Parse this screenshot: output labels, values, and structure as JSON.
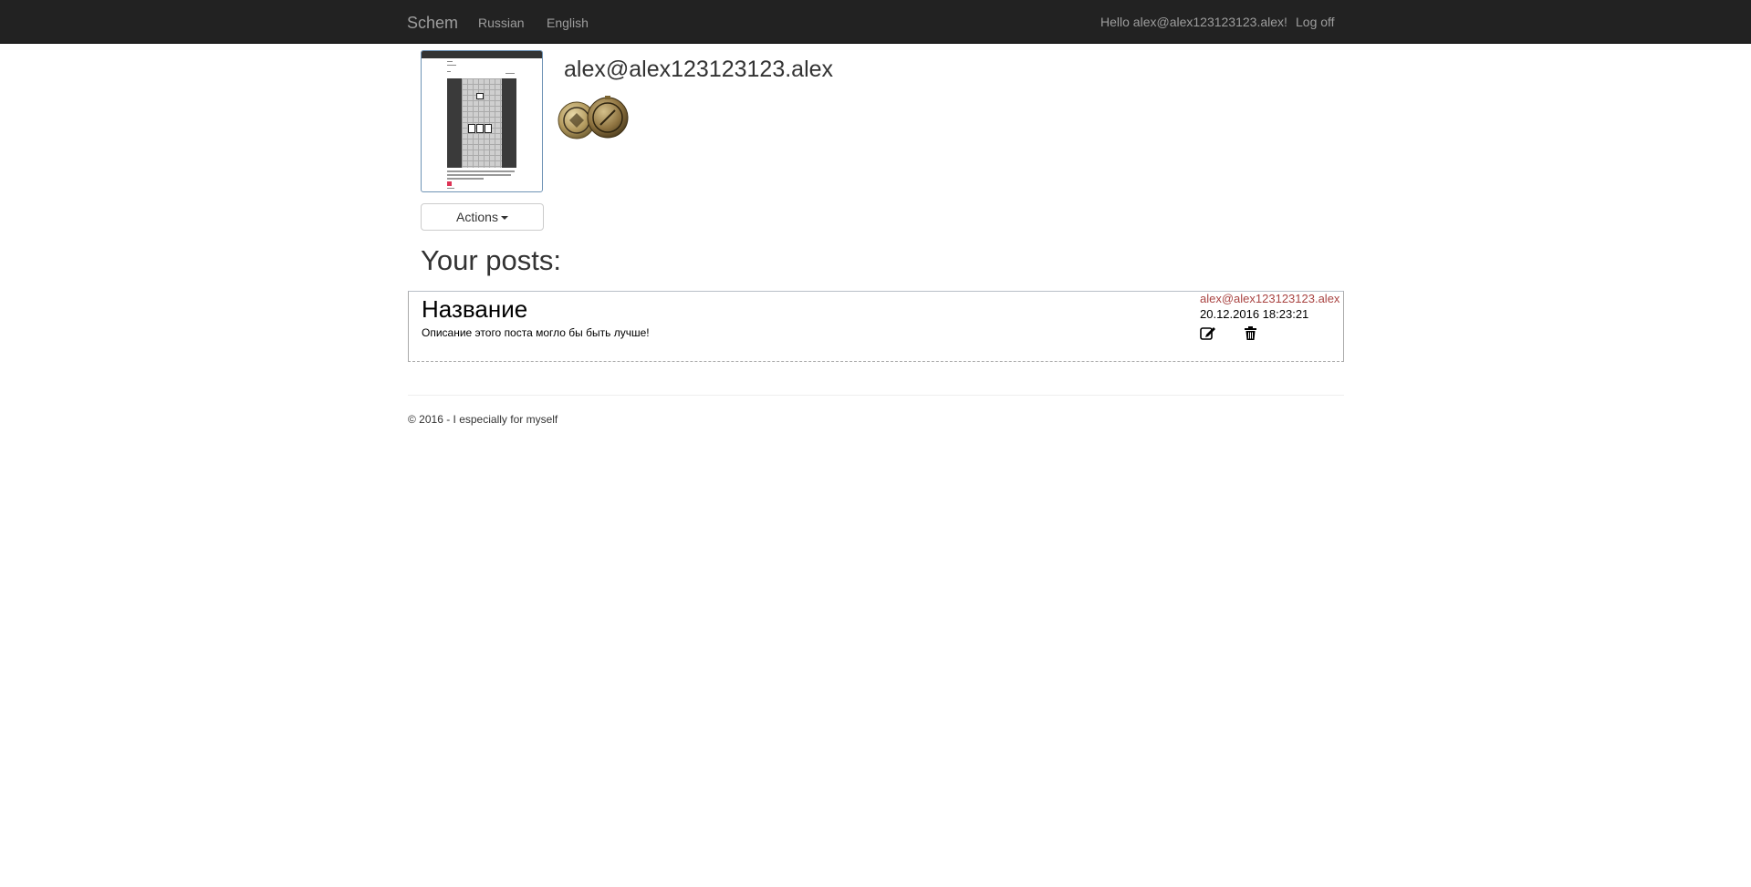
{
  "navbar": {
    "brand": "Schem",
    "languages": [
      "Russian",
      "English"
    ],
    "greeting": "Hello alex@alex123123123.alex!",
    "logoff_label": "Log off"
  },
  "profile": {
    "username": "alex@alex123123123.alex",
    "actions_label": "Actions",
    "medals": [
      "medal-icon",
      "medal-icon"
    ]
  },
  "posts_section": {
    "title": "Your posts:",
    "posts": [
      {
        "title": "Название",
        "description": "Описание этого поста могло бы быть лучше!",
        "author": "alex@alex123123123.alex",
        "date": "20.12.2016 18:23:21",
        "actions": [
          "edit-icon",
          "trash-icon"
        ]
      }
    ]
  },
  "footer": {
    "text": "© 2016 - I especially for myself"
  },
  "colors": {
    "navbar_bg": "#222222",
    "nav_link": "#9d9d9d",
    "author_link": "#a94442"
  }
}
